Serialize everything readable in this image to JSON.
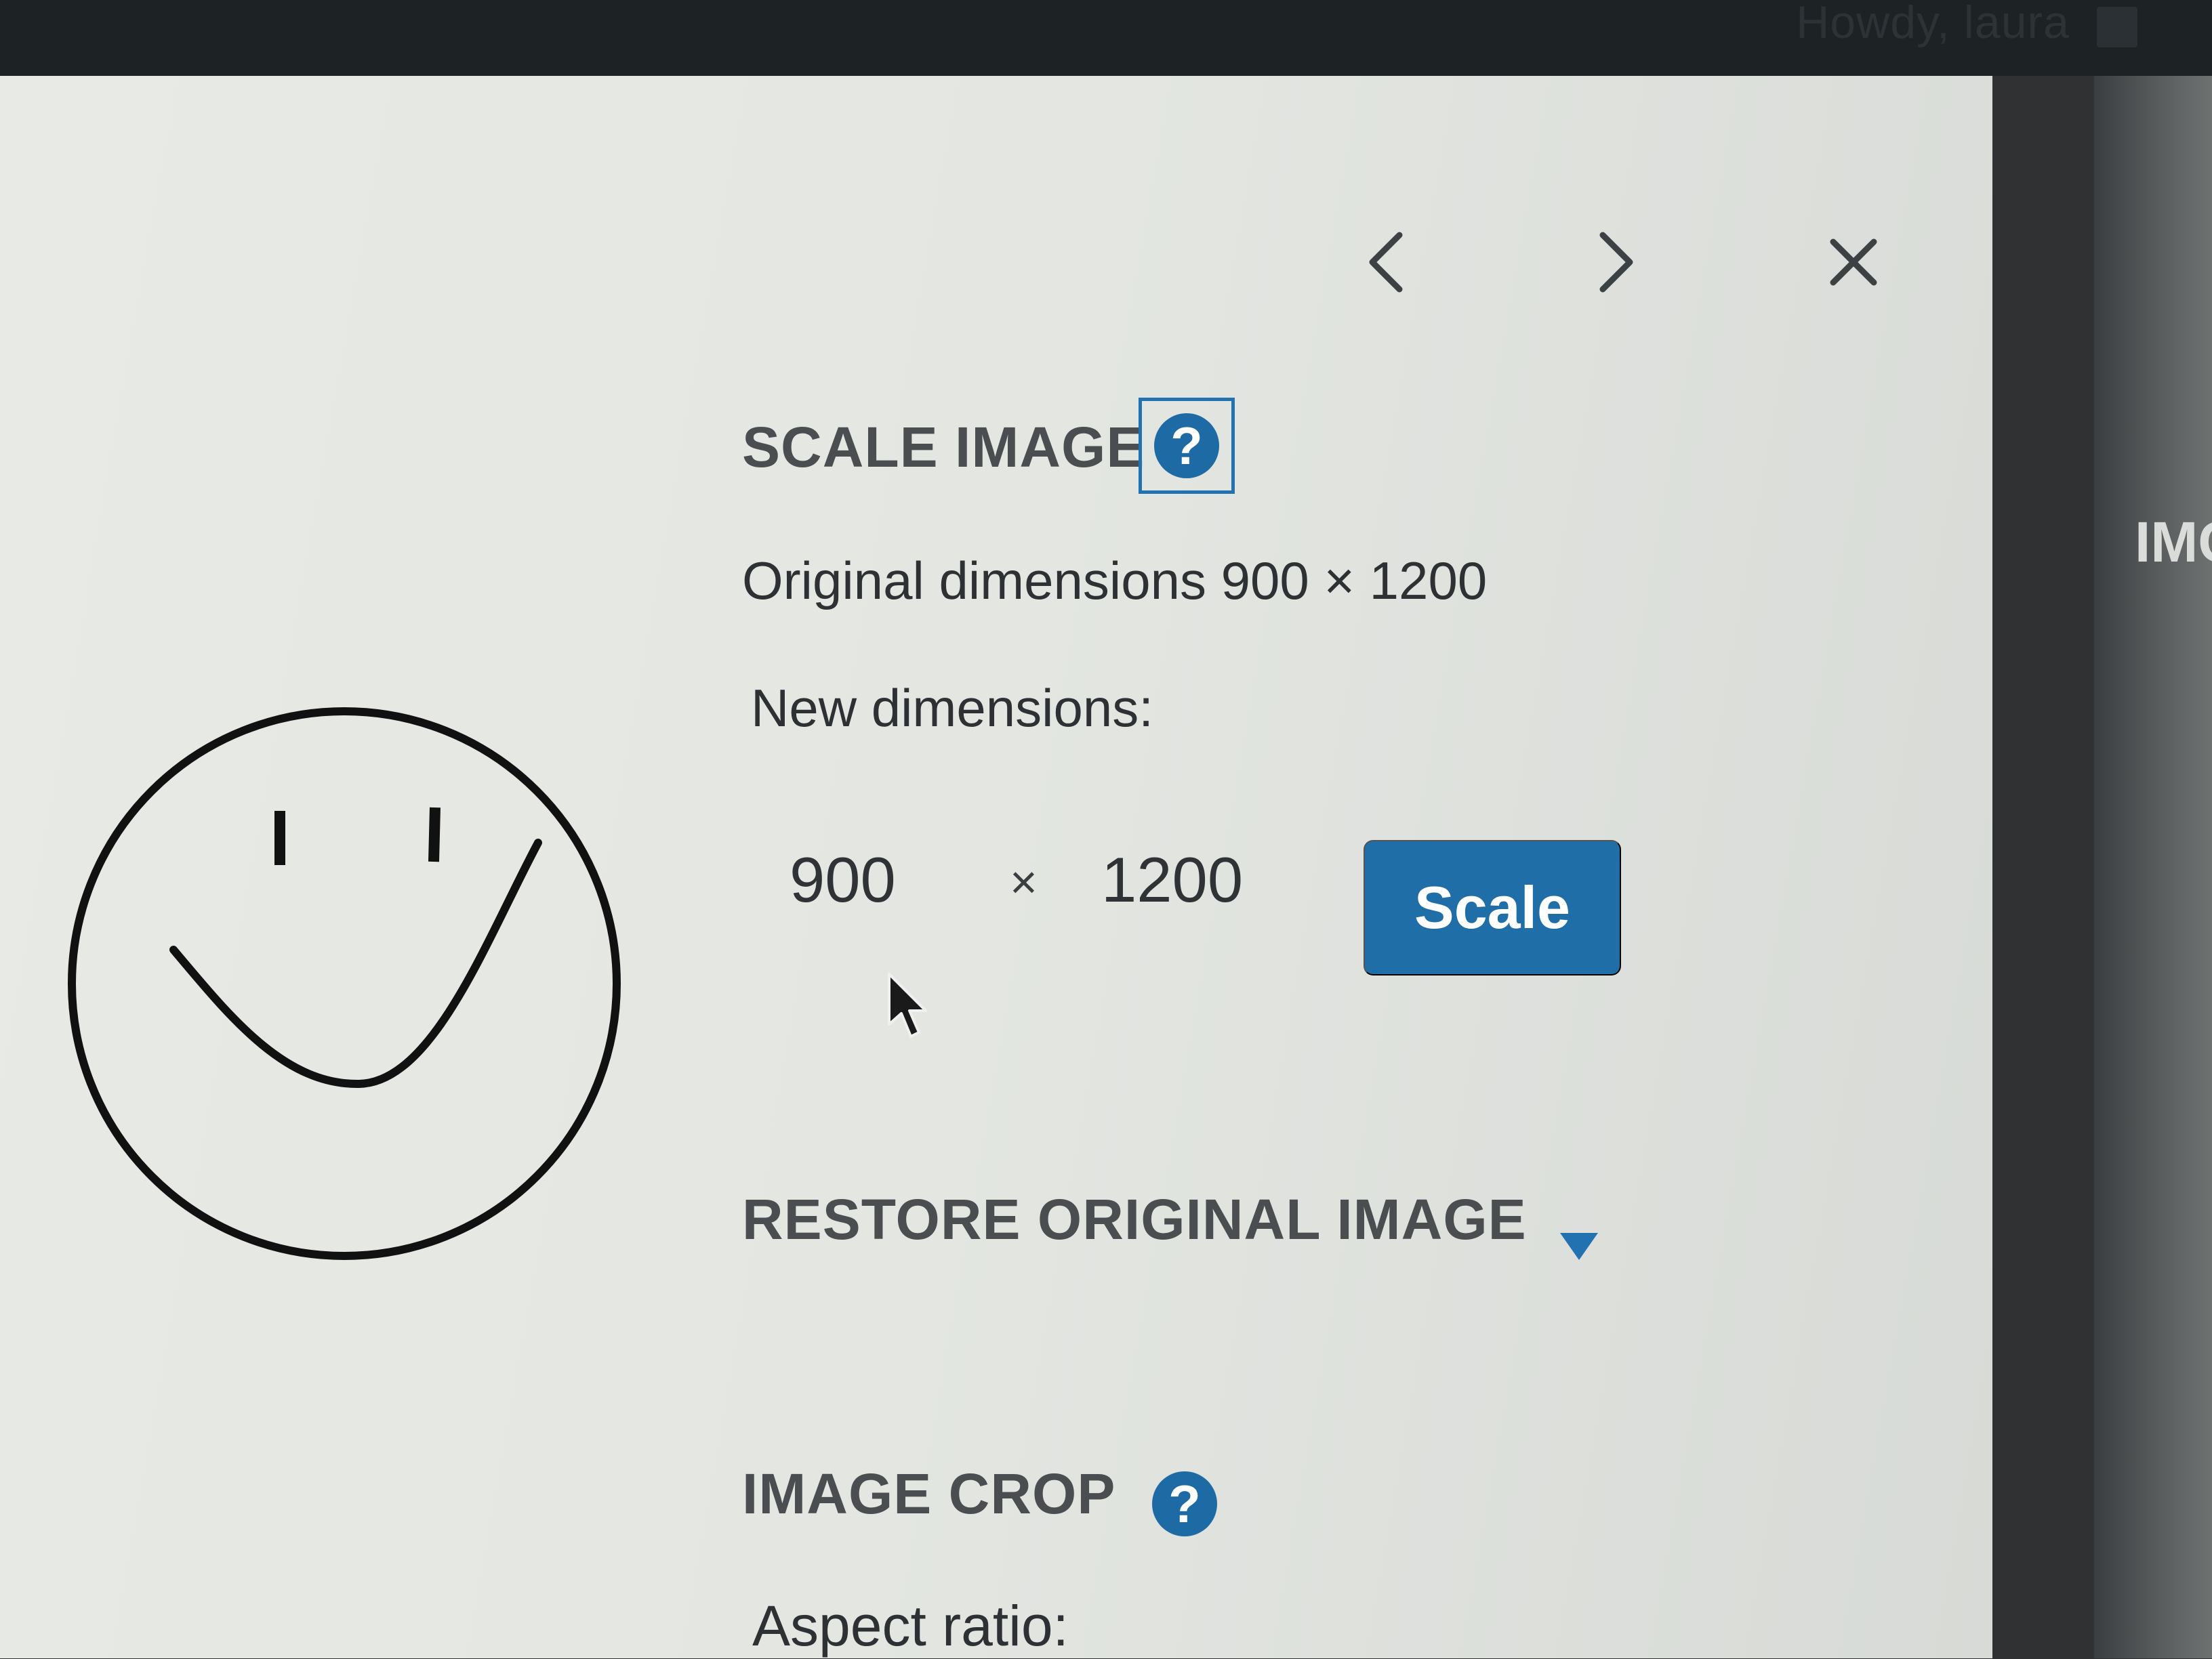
{
  "admin_bar": {
    "greeting": "Howdy, laura"
  },
  "modal": {
    "nav": {
      "prev_icon": "chevron-left-icon",
      "next_icon": "chevron-right-icon",
      "close_icon": "close-icon"
    },
    "scale_image": {
      "title": "SCALE IMAGE",
      "help_label": "?",
      "original_dimensions": "Original dimensions 900 × 1200",
      "new_dimensions_label": "New dimensions:",
      "width_value": "900",
      "height_value": "1200",
      "times_symbol": "×",
      "scale_button": "Scale"
    },
    "restore": {
      "title": "RESTORE ORIGINAL IMAGE"
    },
    "image_crop": {
      "title": "IMAGE CROP",
      "help_label": "?",
      "aspect_ratio_label": "Aspect ratio:"
    }
  },
  "background": {
    "partial_text": "IMC"
  },
  "colors": {
    "accent": "#2271b1",
    "button": "#1f6ea8",
    "text": "#2d3133"
  }
}
